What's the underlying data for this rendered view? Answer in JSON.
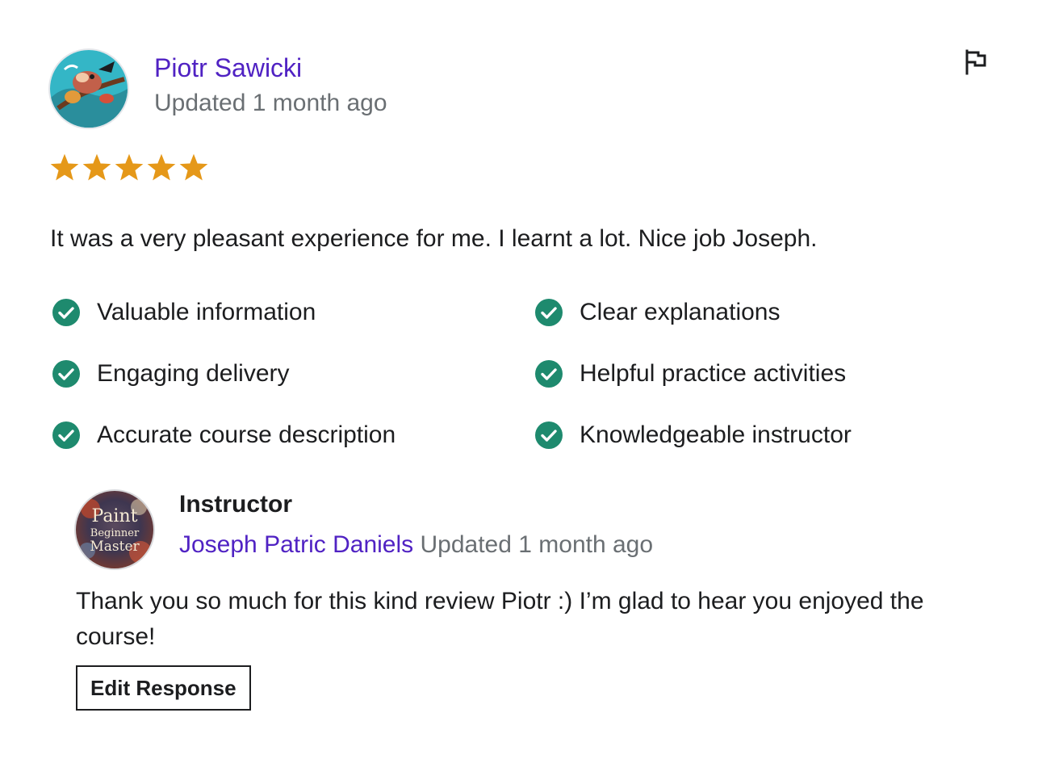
{
  "review": {
    "reviewer_name": "Piotr Sawicki",
    "updated": "Updated 1 month ago",
    "rating": 5,
    "rating_max": 5,
    "star_color": "#e59819",
    "text": "It was a very pleasant experience for me. I learnt a lot. Nice job Joseph.",
    "report_icon": "flag-icon",
    "attributes": [
      {
        "label": "Valuable information",
        "icon": "check-circle-icon"
      },
      {
        "label": "Clear explanations",
        "icon": "check-circle-icon"
      },
      {
        "label": "Engaging delivery",
        "icon": "check-circle-icon"
      },
      {
        "label": "Helpful practice activities",
        "icon": "check-circle-icon"
      },
      {
        "label": "Accurate course description",
        "icon": "check-circle-icon"
      },
      {
        "label": "Knowledgeable instructor",
        "icon": "check-circle-icon"
      }
    ],
    "check_color": "#1e8a6e"
  },
  "response": {
    "role": "Instructor",
    "name": "Joseph Patric Daniels",
    "updated": "Updated 1 month ago",
    "text": "Thank you so much for this kind review Piotr :) I’m glad to hear you enjoyed the course!",
    "avatar_text": [
      "Paint",
      "Beginner",
      "Master"
    ],
    "edit_button_label": "Edit Response"
  },
  "colors": {
    "link": "#5022c3",
    "muted": "#6a6f73",
    "text": "#1c1d1f"
  }
}
